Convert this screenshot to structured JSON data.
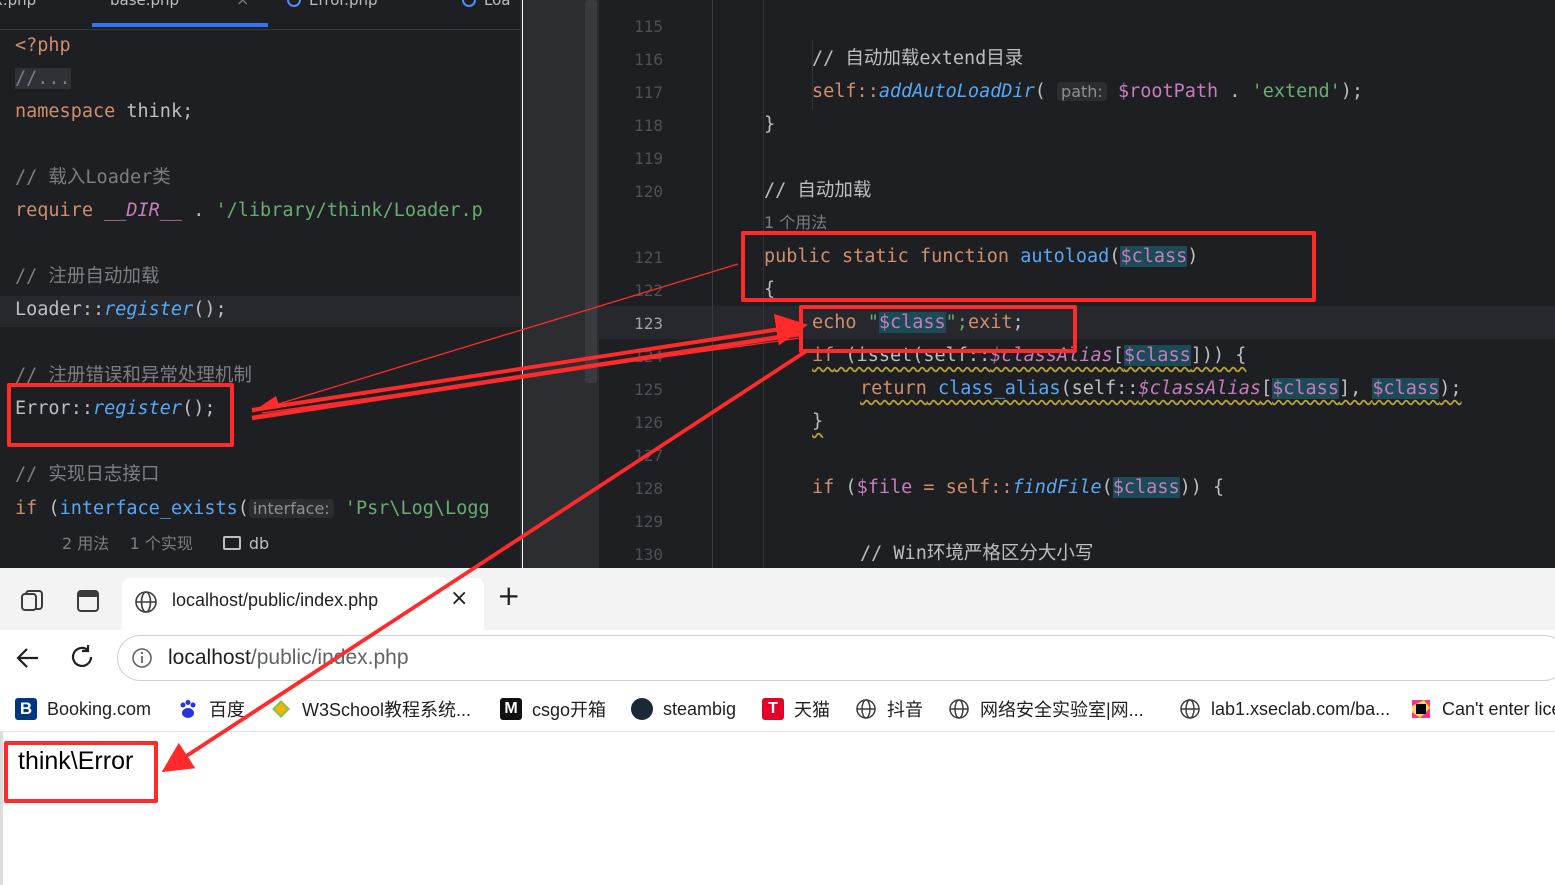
{
  "left_editor": {
    "tabs": [
      {
        "label": "x.php"
      },
      {
        "label": "base.php"
      },
      {
        "label": "Error.php"
      },
      {
        "label": "Loa"
      }
    ],
    "tab_close": "×",
    "lines": {
      "php_open": "<?php",
      "folded": "//...",
      "ns_kw": "namespace",
      "ns_name": " think;",
      "cm_loader": "// 载入Loader类",
      "req_kw": "require",
      "req_dir": " __DIR__",
      "req_dot": " . ",
      "req_path": "'/library/think/Loader.p",
      "cm_autoload": "// 注册自动加载",
      "loader_cls": "Loader::",
      "loader_fn": "register",
      "loader_end": "();",
      "cm_error": "// 注册错误和异常处理机制",
      "error_cls": "Error::",
      "error_fn": "register",
      "error_end": "();",
      "cm_log": "// 实现日志接口",
      "if_kw": "if",
      "if_open": " (",
      "if_fn": "interface_exists",
      "if_paren": "(",
      "if_hint": "interface:",
      "if_str": " 'Psr\\Log\\Logg",
      "bottom_usage": "2 用法    1 个实现",
      "bottom_db": "db"
    }
  },
  "right_editor": {
    "line_numbers": [
      "115",
      "116",
      "117",
      "118",
      "119",
      "120",
      "121",
      "122",
      "123",
      "124",
      "125",
      "126",
      "127",
      "128",
      "129",
      "130"
    ],
    "cm_extend": "// 自动加载extend目录",
    "self1": "self::",
    "add_fn": "addAutoLoadDir",
    "paren1": "(",
    "path_hint": "path:",
    "root_var": " $rootPath",
    "dot1": " . ",
    "extend_str": "'extend'",
    "end1": ");",
    "brace_close1": "}",
    "cm_autoload": "// 自动加载",
    "usage": "1 个用法",
    "pub": "public static function ",
    "autoload_fn": "autoload",
    "param_open": "(",
    "param_class": "$class",
    "param_close": ")",
    "brace_open": "{",
    "echo_kw": "echo",
    "echo_q1": " \"",
    "echo_var": "$class",
    "echo_q2": "\";",
    "exit_kw": "exit",
    "echo_end": ";",
    "if_kw": "if",
    "isset_open": " (isset(self::",
    "class_alias_var": "$classAlias",
    "br_open": "[",
    "class_var2": "$class",
    "br_close": "])) {",
    "return_kw": "return",
    "class_alias_fn": " class_alias",
    "ret_open": "(self::",
    "class_alias_var2": "$classAlias",
    "ret_br": "[",
    "class_var3": "$class",
    "ret_mid": "], ",
    "class_var4": "$class",
    "ret_end": ");",
    "brace_close2": "}",
    "if2_kw": "if",
    "file_open": " (",
    "file_var": "$file",
    "file_eq": " = self::",
    "find_fn": "findFile",
    "find_open": "(",
    "class_var5": "$class",
    "find_end": ")) {",
    "cm_win": "// Win环境严格区分大小写"
  },
  "browser": {
    "tab_title": "localhost/public/index.php",
    "tab_close": "×",
    "new_tab": "+",
    "url_host": "localhost",
    "url_path": "/public/index.php",
    "bookmarks": [
      {
        "label": "Booking.com",
        "icon": "booking-icon",
        "color": "#003580"
      },
      {
        "label": "百度",
        "icon": "baidu-paw-icon",
        "color": "#2932e1"
      },
      {
        "label": "W3School教程系统...",
        "icon": "w3school-icon",
        "color": "#8bc34a"
      },
      {
        "label": "csgo开箱",
        "icon": "csgo-icon",
        "color": "#111111"
      },
      {
        "label": "steambig",
        "icon": "steam-icon",
        "color": "#1b2838"
      },
      {
        "label": "天猫",
        "icon": "tmall-icon",
        "color": "#e4002b"
      },
      {
        "label": "抖音",
        "icon": "globe-icon",
        "color": "#3c3c3c"
      },
      {
        "label": "网络安全实验室|网...",
        "icon": "globe-icon",
        "color": "#3c3c3c"
      },
      {
        "label": "lab1.xseclab.com/ba...",
        "icon": "globe-icon",
        "color": "#3c3c3c"
      },
      {
        "label": "Can't enter lice",
        "icon": "jetbrains-icon",
        "color": "#ff318c"
      }
    ],
    "output": "think\\Error"
  },
  "annotation_color": "#ff2a2a"
}
